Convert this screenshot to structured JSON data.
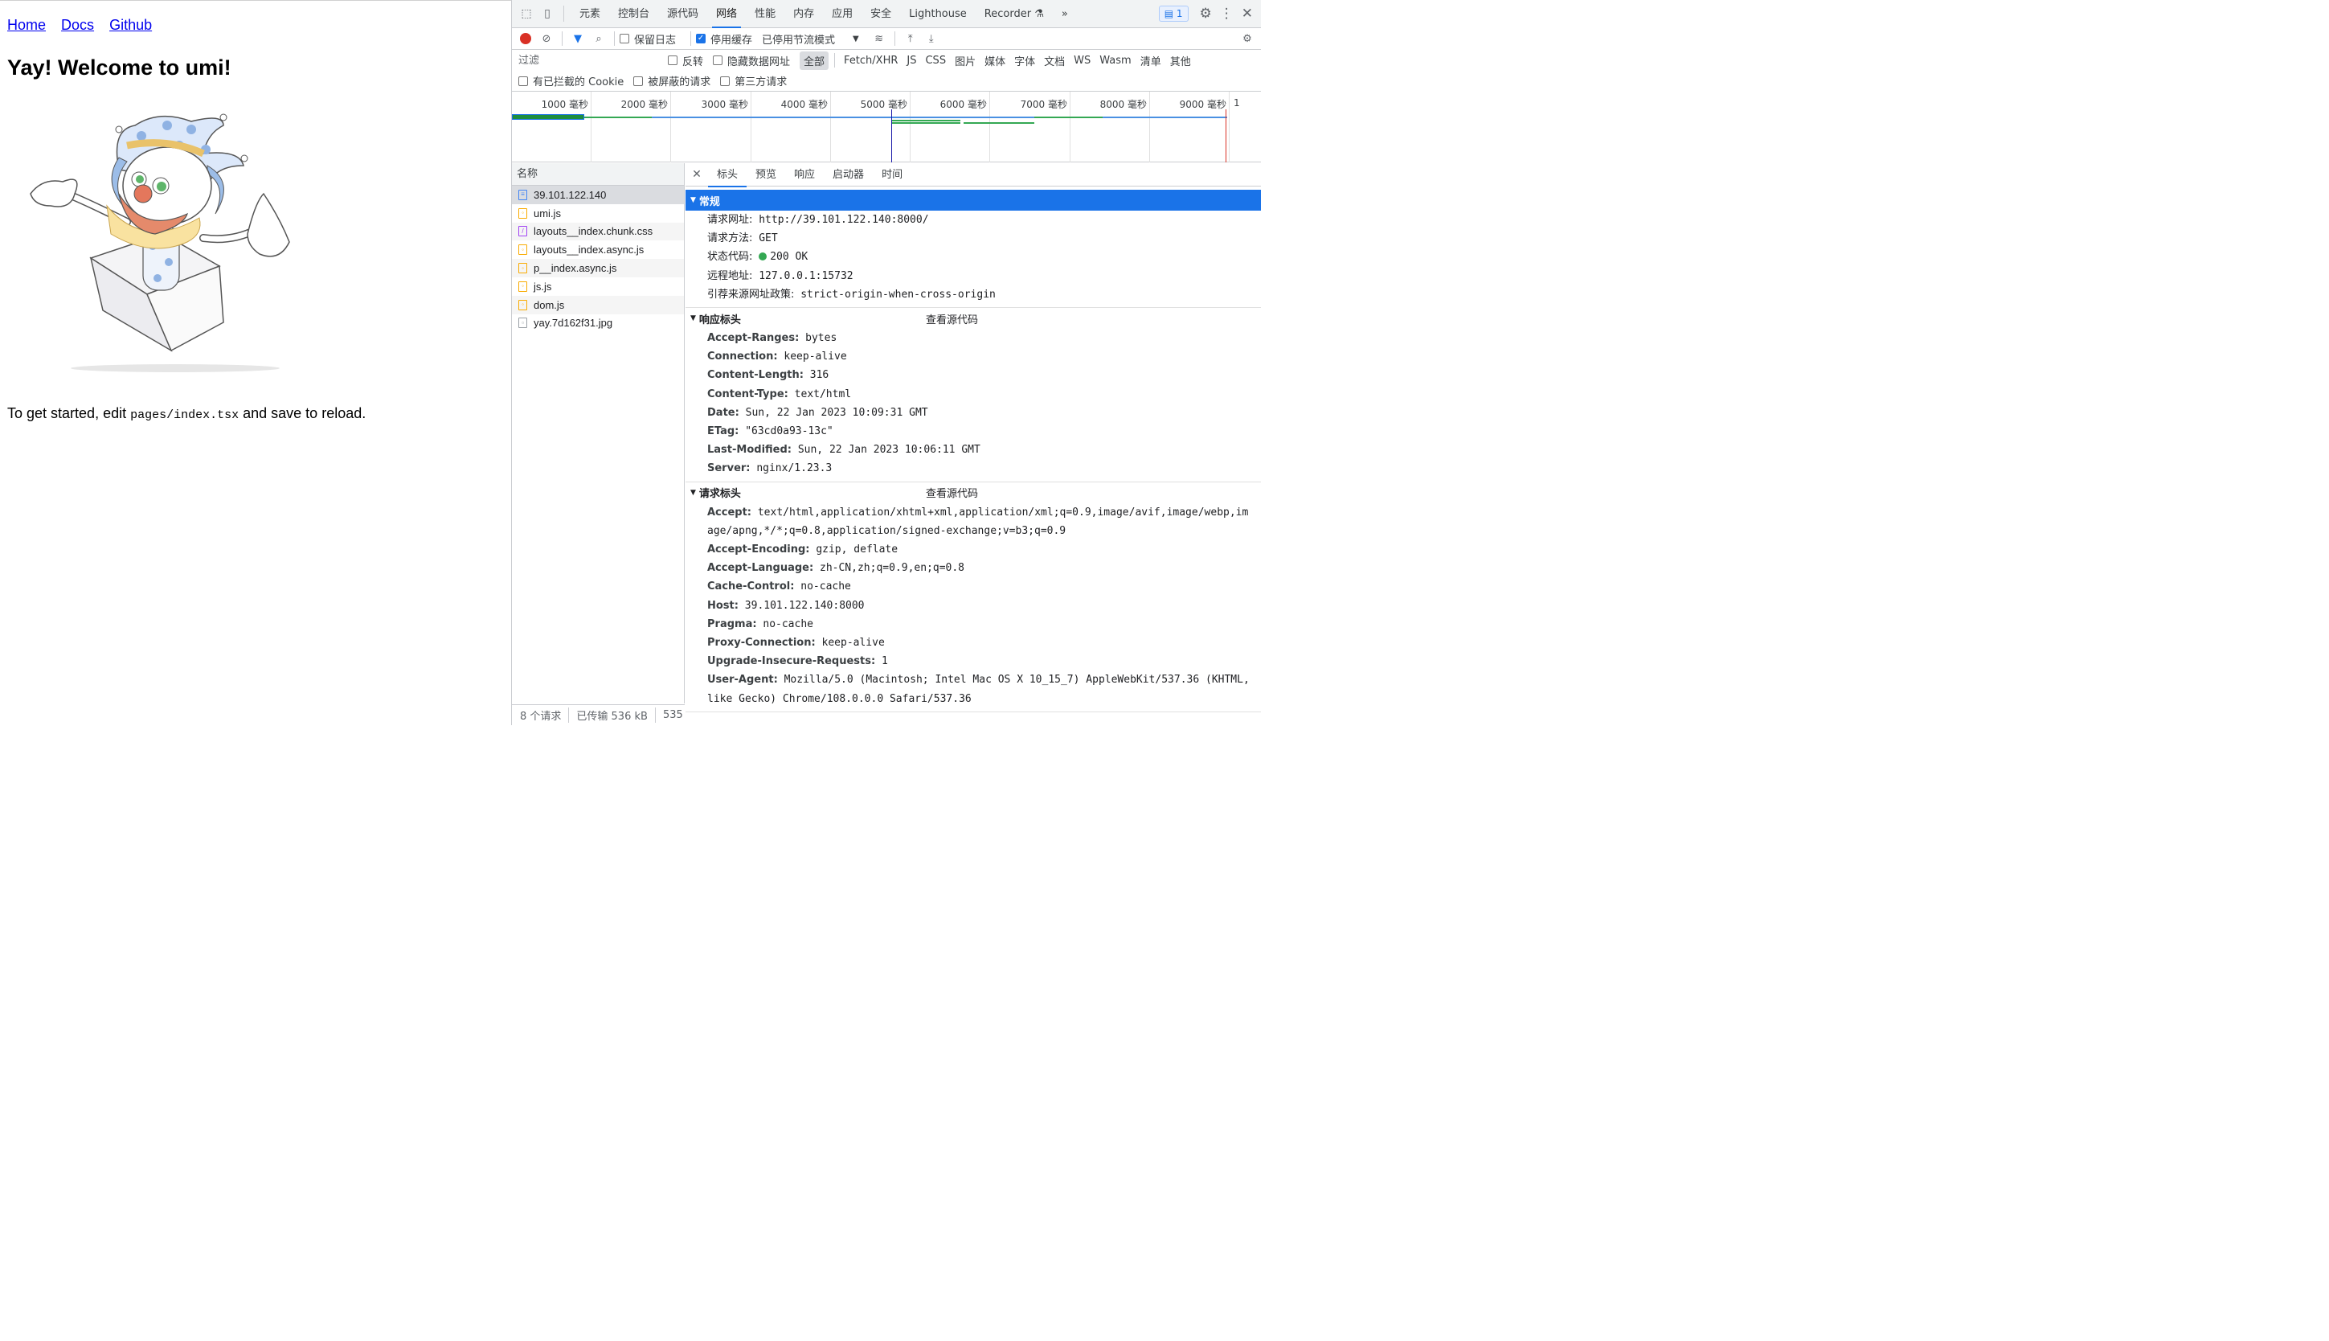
{
  "page": {
    "nav": [
      "Home",
      "Docs",
      "Github"
    ],
    "title": "Yay! Welcome to umi!",
    "hint_prefix": "To get started, edit ",
    "hint_code": "pages/index.tsx",
    "hint_suffix": " and save to reload."
  },
  "devtools": {
    "tabs": [
      "元素",
      "控制台",
      "源代码",
      "网络",
      "性能",
      "内存",
      "应用",
      "安全",
      "Lighthouse",
      "Recorder"
    ],
    "active_tab": "网络",
    "message_count": "1",
    "toolbar": {
      "preserve_log": "保留日志",
      "disable_cache": "停用缓存",
      "throttle": "已停用节流模式"
    },
    "filter": {
      "placeholder": "过滤",
      "invert": "反转",
      "hide_data_urls": "隐藏数据网址",
      "types": [
        "全部",
        "Fetch/XHR",
        "JS",
        "CSS",
        "图片",
        "媒体",
        "字体",
        "文档",
        "WS",
        "Wasm",
        "清单",
        "其他"
      ],
      "blocked_cookies": "有已拦截的 Cookie",
      "blocked_requests": "被屏蔽的请求",
      "third_party": "第三方请求"
    },
    "timeline_ticks": [
      "1000 毫秒",
      "2000 毫秒",
      "3000 毫秒",
      "4000 毫秒",
      "5000 毫秒",
      "6000 毫秒",
      "7000 毫秒",
      "8000 毫秒",
      "9000 毫秒",
      "1"
    ],
    "requests": {
      "header": "名称",
      "items": [
        {
          "name": "39.101.122.140",
          "type": "doc"
        },
        {
          "name": "umi.js",
          "type": "js"
        },
        {
          "name": "layouts__index.chunk.css",
          "type": "css"
        },
        {
          "name": "layouts__index.async.js",
          "type": "js"
        },
        {
          "name": "p__index.async.js",
          "type": "js"
        },
        {
          "name": "js.js",
          "type": "js"
        },
        {
          "name": "dom.js",
          "type": "js"
        },
        {
          "name": "yay.7d162f31.jpg",
          "type": "img"
        }
      ]
    },
    "status": {
      "count": "8 个请求",
      "transferred": "已传输 536 kB",
      "resources": "535"
    },
    "detail_tabs": [
      "标头",
      "预览",
      "响应",
      "启动器",
      "时间"
    ],
    "general": {
      "title": "常规",
      "rows": [
        {
          "k": "请求网址:",
          "v": "http://39.101.122.140:8000/"
        },
        {
          "k": "请求方法:",
          "v": "GET"
        },
        {
          "k": "状态代码:",
          "v": "200 OK"
        },
        {
          "k": "远程地址:",
          "v": "127.0.0.1:15732"
        },
        {
          "k": "引荐来源网址政策:",
          "v": "strict-origin-when-cross-origin"
        }
      ]
    },
    "response_headers": {
      "title": "响应标头",
      "view_source": "查看源代码",
      "rows": [
        {
          "k": "Accept-Ranges:",
          "v": "bytes"
        },
        {
          "k": "Connection:",
          "v": "keep-alive"
        },
        {
          "k": "Content-Length:",
          "v": "316"
        },
        {
          "k": "Content-Type:",
          "v": "text/html"
        },
        {
          "k": "Date:",
          "v": "Sun, 22 Jan 2023 10:09:31 GMT"
        },
        {
          "k": "ETag:",
          "v": "\"63cd0a93-13c\""
        },
        {
          "k": "Last-Modified:",
          "v": "Sun, 22 Jan 2023 10:06:11 GMT"
        },
        {
          "k": "Server:",
          "v": "nginx/1.23.3"
        }
      ]
    },
    "request_headers": {
      "title": "请求标头",
      "view_source": "查看源代码",
      "rows": [
        {
          "k": "Accept:",
          "v": "text/html,application/xhtml+xml,application/xml;q=0.9,image/avif,image/webp,image/apng,*/*;q=0.8,application/signed-exchange;v=b3;q=0.9"
        },
        {
          "k": "Accept-Encoding:",
          "v": "gzip, deflate"
        },
        {
          "k": "Accept-Language:",
          "v": "zh-CN,zh;q=0.9,en;q=0.8"
        },
        {
          "k": "Cache-Control:",
          "v": "no-cache"
        },
        {
          "k": "Host:",
          "v": "39.101.122.140:8000"
        },
        {
          "k": "Pragma:",
          "v": "no-cache"
        },
        {
          "k": "Proxy-Connection:",
          "v": "keep-alive"
        },
        {
          "k": "Upgrade-Insecure-Requests:",
          "v": "1"
        },
        {
          "k": "User-Agent:",
          "v": "Mozilla/5.0 (Macintosh; Intel Mac OS X 10_15_7) AppleWebKit/537.36 (KHTML, like Gecko) Chrome/108.0.0.0 Safari/537.36"
        }
      ]
    }
  }
}
